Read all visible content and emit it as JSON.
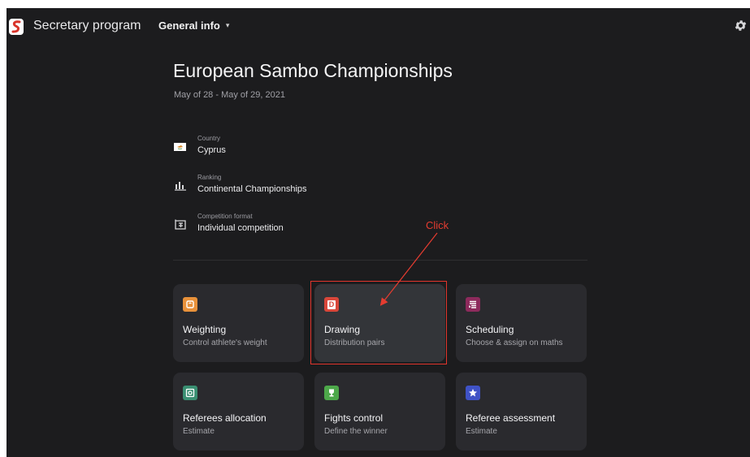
{
  "app": {
    "title": "Secretary program",
    "nav_label": "General info",
    "nav_chevron": "▾"
  },
  "event": {
    "title": "European Sambo Championships",
    "dates": "May of 28 - May of 29, 2021"
  },
  "info": [
    {
      "label": "Country",
      "value": "Cyprus",
      "icon": "flag-icon"
    },
    {
      "label": "Ranking",
      "value": "Continental Championships",
      "icon": "bar-chart-icon"
    },
    {
      "label": "Competition format",
      "value": "Individual competition",
      "icon": "competition-format-icon"
    }
  ],
  "cards": [
    {
      "title": "Weighting",
      "subtitle": "Control athlete's weight",
      "icon": "weighting-icon",
      "color": "#e8913a"
    },
    {
      "title": "Drawing",
      "subtitle": "Distribution pairs",
      "icon": "drawing-icon",
      "color": "#d9473a",
      "glyph": "D"
    },
    {
      "title": "Scheduling",
      "subtitle": "Choose & assign on maths",
      "icon": "scheduling-icon",
      "color": "#8d2a5c"
    },
    {
      "title": "Referees allocation",
      "subtitle": "Estimate",
      "icon": "referees-allocation-icon",
      "color": "#3a8f72"
    },
    {
      "title": "Fights control",
      "subtitle": "Define the winner",
      "icon": "trophy-icon",
      "color": "#4da84a"
    },
    {
      "title": "Referee assessment",
      "subtitle": "Estimate",
      "icon": "star-icon",
      "color": "#3f52c6"
    }
  ],
  "annotation": {
    "text": "Click",
    "color": "#e53c30"
  },
  "colors": {
    "background": "#1c1c1e",
    "card": "#2a2a2e"
  }
}
